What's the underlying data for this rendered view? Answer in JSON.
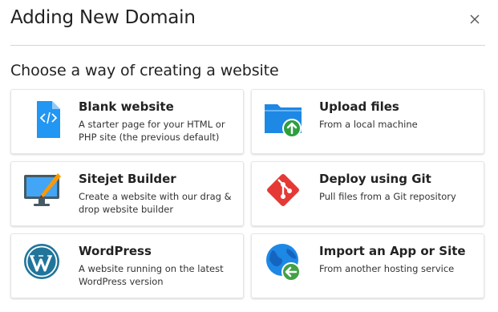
{
  "dialog": {
    "title": "Adding New Domain",
    "subtitle": "Choose a way of creating a website"
  },
  "options": [
    {
      "name": "Blank website",
      "desc": "A starter page for your HTML or PHP site (the previous default)",
      "icon": "file-code-icon"
    },
    {
      "name": "Upload files",
      "desc": "From a local machine",
      "icon": "folder-upload-icon"
    },
    {
      "name": "Sitejet Builder",
      "desc": "Create a website with our drag & drop website builder",
      "icon": "monitor-brush-icon"
    },
    {
      "name": "Deploy using Git",
      "desc": "Pull files from a Git repository",
      "icon": "git-icon"
    },
    {
      "name": "WordPress",
      "desc": "A website running on the latest WordPress version",
      "icon": "wordpress-icon"
    },
    {
      "name": "Import an App or Site",
      "desc": "From another hosting service",
      "icon": "globe-import-icon"
    }
  ],
  "colors": {
    "accent_blue": "#1E88E5",
    "git_red": "#E53935",
    "upload_green": "#2E9E3F",
    "wordpress_blue": "#21759B"
  }
}
